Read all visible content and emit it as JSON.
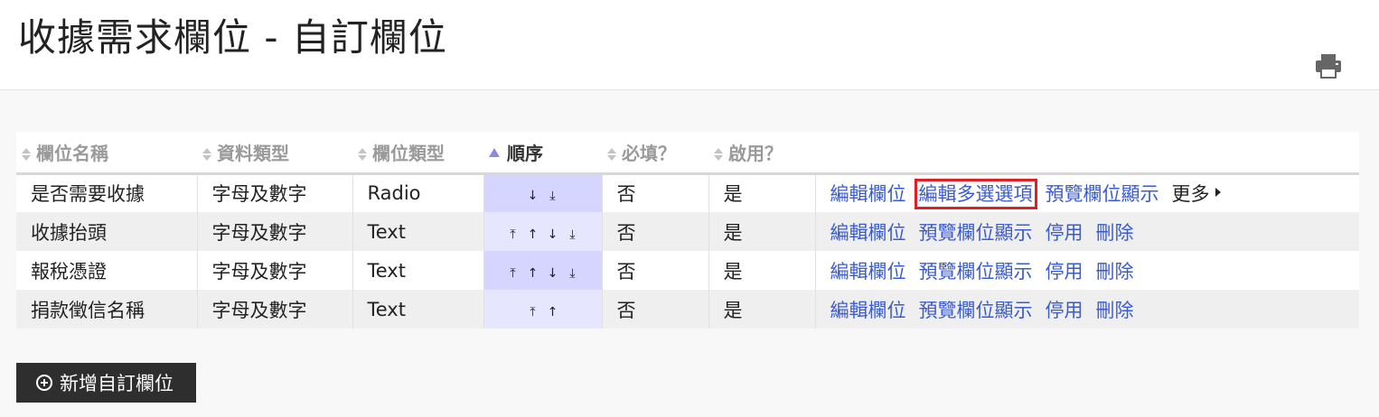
{
  "header": {
    "title": "收據需求欄位 - 自訂欄位",
    "print_icon": "printer-icon"
  },
  "table": {
    "columns": [
      {
        "label": "欄位名稱",
        "sortable": true,
        "sorted": false
      },
      {
        "label": "資料類型",
        "sortable": true,
        "sorted": false
      },
      {
        "label": "欄位類型",
        "sortable": true,
        "sorted": false
      },
      {
        "label": "順序",
        "sortable": true,
        "sorted": true,
        "direction": "asc"
      },
      {
        "label": "必填？",
        "sortable": true,
        "sorted": false
      },
      {
        "label": "啟用？",
        "sortable": true,
        "sorted": false
      },
      {
        "label": "",
        "sortable": false,
        "sorted": false
      }
    ],
    "rows": [
      {
        "name": "是否需要收據",
        "data_type": "字母及數字",
        "field_type": "Radio",
        "order_controls": [
          "move-down",
          "move-bottom"
        ],
        "required": "否",
        "enabled": "是",
        "actions": [
          {
            "label": "編輯欄位",
            "highlighted": false
          },
          {
            "label": "編輯多選選項",
            "highlighted": true
          },
          {
            "label": "預覽欄位顯示",
            "highlighted": false
          }
        ],
        "more_label": "更多"
      },
      {
        "name": "收據抬頭",
        "data_type": "字母及數字",
        "field_type": "Text",
        "order_controls": [
          "move-top",
          "move-up",
          "move-down",
          "move-bottom"
        ],
        "required": "否",
        "enabled": "是",
        "actions": [
          {
            "label": "編輯欄位",
            "highlighted": false
          },
          {
            "label": "預覽欄位顯示",
            "highlighted": false
          },
          {
            "label": "停用",
            "highlighted": false
          },
          {
            "label": "刪除",
            "highlighted": false
          }
        ]
      },
      {
        "name": "報稅憑證",
        "data_type": "字母及數字",
        "field_type": "Text",
        "order_controls": [
          "move-top",
          "move-up",
          "move-down",
          "move-bottom"
        ],
        "required": "否",
        "enabled": "是",
        "actions": [
          {
            "label": "編輯欄位",
            "highlighted": false
          },
          {
            "label": "預覽欄位顯示",
            "highlighted": false
          },
          {
            "label": "停用",
            "highlighted": false
          },
          {
            "label": "刪除",
            "highlighted": false
          }
        ]
      },
      {
        "name": "捐款徵信名稱",
        "data_type": "字母及數字",
        "field_type": "Text",
        "order_controls": [
          "move-top",
          "move-up"
        ],
        "required": "否",
        "enabled": "是",
        "actions": [
          {
            "label": "編輯欄位",
            "highlighted": false
          },
          {
            "label": "預覽欄位顯示",
            "highlighted": false
          },
          {
            "label": "停用",
            "highlighted": false
          },
          {
            "label": "刪除",
            "highlighted": false
          }
        ]
      }
    ]
  },
  "add_button": {
    "label": "新增自訂欄位",
    "icon": "plus-circle-icon"
  },
  "colors": {
    "link": "#3a5bcf",
    "highlight": "#e01e25",
    "order_cell": "#d5d5ff",
    "button_bg": "#2e2e2e"
  }
}
